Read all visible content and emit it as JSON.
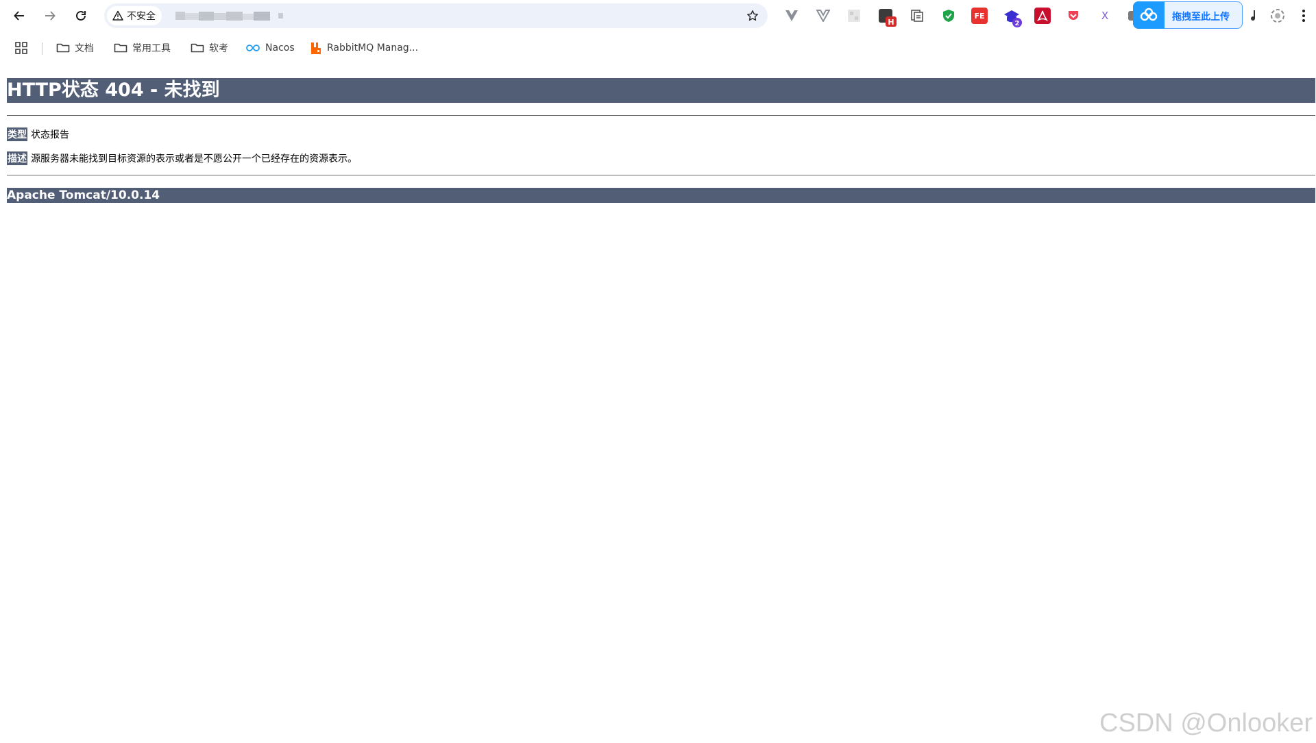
{
  "browser": {
    "security_label": "不安全",
    "upload_label": "拖拽至此上传"
  },
  "bookmarks": [
    {
      "label": "文档",
      "icon": "folder-icon"
    },
    {
      "label": "常用工具",
      "icon": "folder-icon"
    },
    {
      "label": "软考",
      "icon": "folder-icon"
    },
    {
      "label": "Nacos",
      "icon": "nacos-icon"
    },
    {
      "label": "RabbitMQ Manag...",
      "icon": "rabbitmq-icon"
    }
  ],
  "page": {
    "title": "HTTP状态 404 - 未找到",
    "type_label": "类型",
    "type_value": "状态报告",
    "desc_label": "描述",
    "desc_value": "源服务器未能找到目标资源的表示或者是不愿公开一个已经存在的资源表示。",
    "footer": "Apache Tomcat/10.0.14"
  },
  "watermark": "CSDN @Onlooker .",
  "colors": {
    "tomcat_header": "#525d76",
    "omnibox": "#edf2fa",
    "upload_accent": "#1e9bff"
  }
}
